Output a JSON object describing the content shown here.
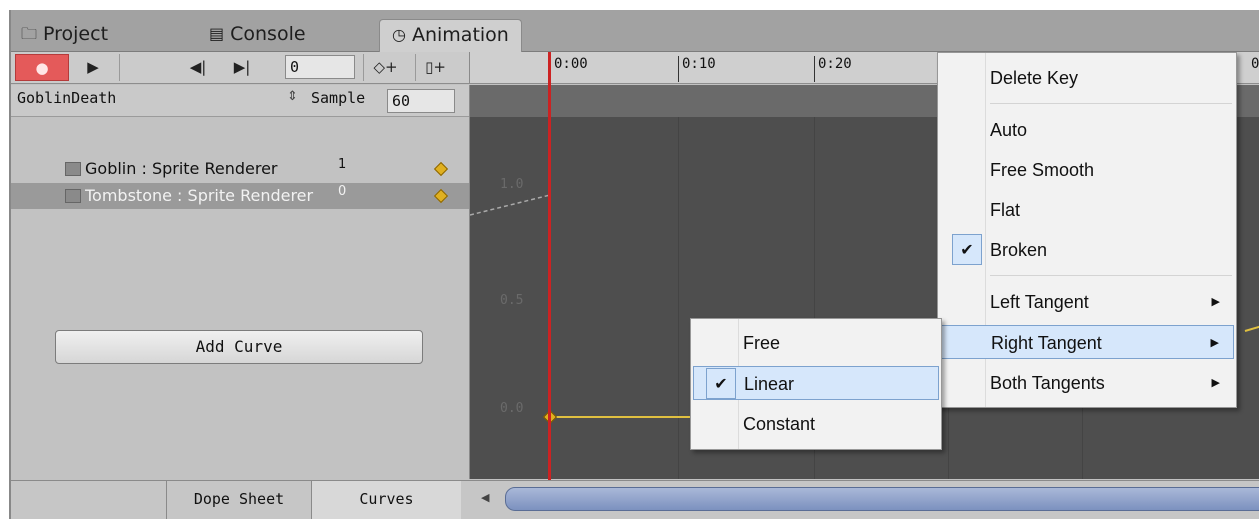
{
  "tabs": [
    {
      "label": "Project",
      "icon": "folder-icon"
    },
    {
      "label": "Console",
      "icon": "console-icon"
    },
    {
      "label": "Animation",
      "icon": "clock-icon"
    }
  ],
  "toolbar": {
    "frame_value": "0"
  },
  "clip": {
    "name": "GoblinDeath",
    "sample_label": "Sample",
    "sample_value": "60"
  },
  "properties": [
    {
      "name": "Goblin : Sprite Renderer",
      "value": "1"
    },
    {
      "name": "Tombstone : Sprite Renderer",
      "value": "0"
    }
  ],
  "add_curve_label": "Add Curve",
  "bottom_tabs": {
    "dope_sheet": "Dope Sheet",
    "curves": "Curves"
  },
  "timeline": {
    "ticks": [
      "0:00",
      "0:10",
      "0:20",
      "0"
    ]
  },
  "curve_axis": {
    "y_labels": [
      "1.0",
      "0.5",
      "0.0"
    ]
  },
  "context_menu": {
    "delete_key": "Delete Key",
    "auto": "Auto",
    "free_smooth": "Free Smooth",
    "flat": "Flat",
    "broken": "Broken",
    "left_tangent": "Left Tangent",
    "right_tangent": "Right Tangent",
    "both_tangents": "Both Tangents"
  },
  "submenu": {
    "free": "Free",
    "linear": "Linear",
    "constant": "Constant"
  },
  "colors": {
    "playhead": "#cc2222",
    "curve": "#e0c040",
    "record": "#e45a5a",
    "menu_highlight": "#d6e7fb"
  }
}
